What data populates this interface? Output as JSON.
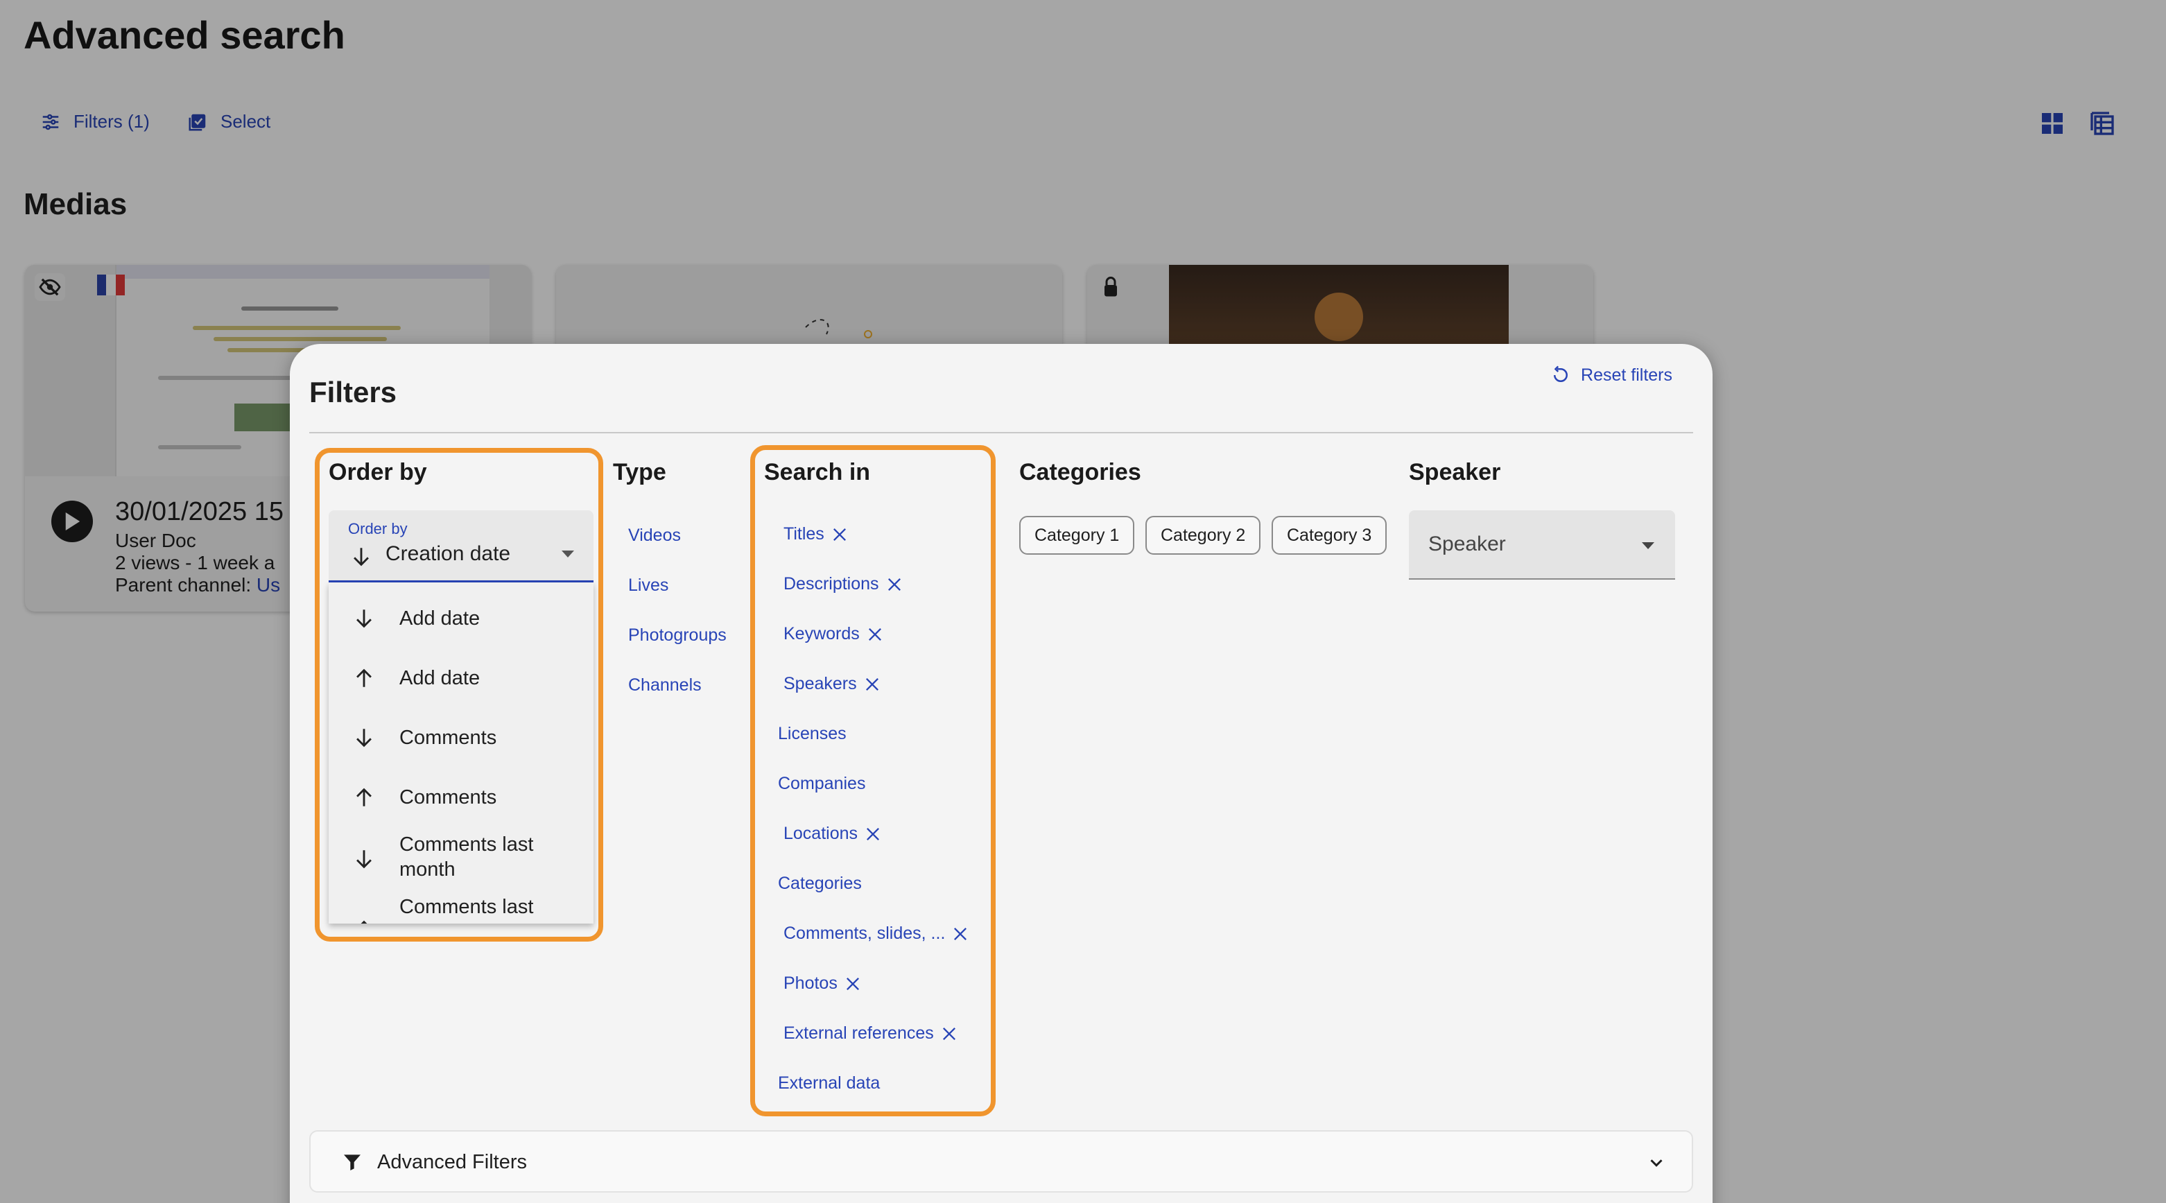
{
  "page": {
    "title": "Advanced search",
    "filters_button": "Filters (1)",
    "select_button": "Select",
    "section_title": "Medias"
  },
  "card": {
    "title": "30/01/2025 15",
    "author": "User Doc",
    "stats": "2 views  - 1 week a",
    "parent_prefix": "Parent channel: ",
    "parent_link": "Us"
  },
  "filters": {
    "title": "Filters",
    "reset_label": "Reset filters",
    "order_by": {
      "heading": "Order by",
      "field_label": "Order by",
      "selected": "Creation date",
      "options": [
        {
          "label": "Add date",
          "direction": "down"
        },
        {
          "label": "Add date",
          "direction": "up"
        },
        {
          "label": "Comments",
          "direction": "down"
        },
        {
          "label": "Comments",
          "direction": "up"
        },
        {
          "label": "Comments last month",
          "direction": "down"
        },
        {
          "label": "Comments last",
          "direction": "up"
        }
      ]
    },
    "type": {
      "heading": "Type",
      "options": [
        "Videos",
        "Lives",
        "Photogroups",
        "Channels"
      ]
    },
    "search_in": {
      "heading": "Search in",
      "options": [
        {
          "label": "Titles",
          "selected": true
        },
        {
          "label": "Descriptions",
          "selected": true
        },
        {
          "label": "Keywords",
          "selected": true
        },
        {
          "label": "Speakers",
          "selected": true
        },
        {
          "label": "Licenses",
          "selected": false
        },
        {
          "label": "Companies",
          "selected": false
        },
        {
          "label": "Locations",
          "selected": true
        },
        {
          "label": "Categories",
          "selected": false
        },
        {
          "label": "Comments, slides, ...",
          "selected": true
        },
        {
          "label": "Photos",
          "selected": true
        },
        {
          "label": "External references",
          "selected": true
        },
        {
          "label": "External data",
          "selected": false
        }
      ]
    },
    "categories": {
      "heading": "Categories",
      "chips": [
        "Category 1",
        "Category 2",
        "Category 3"
      ]
    },
    "speaker": {
      "heading": "Speaker",
      "placeholder": "Speaker"
    },
    "advanced_label": "Advanced Filters"
  },
  "colors": {
    "accent": "#2844b6",
    "highlight": "#f0952e",
    "overlay": "rgba(0,0,0,0.35)"
  }
}
